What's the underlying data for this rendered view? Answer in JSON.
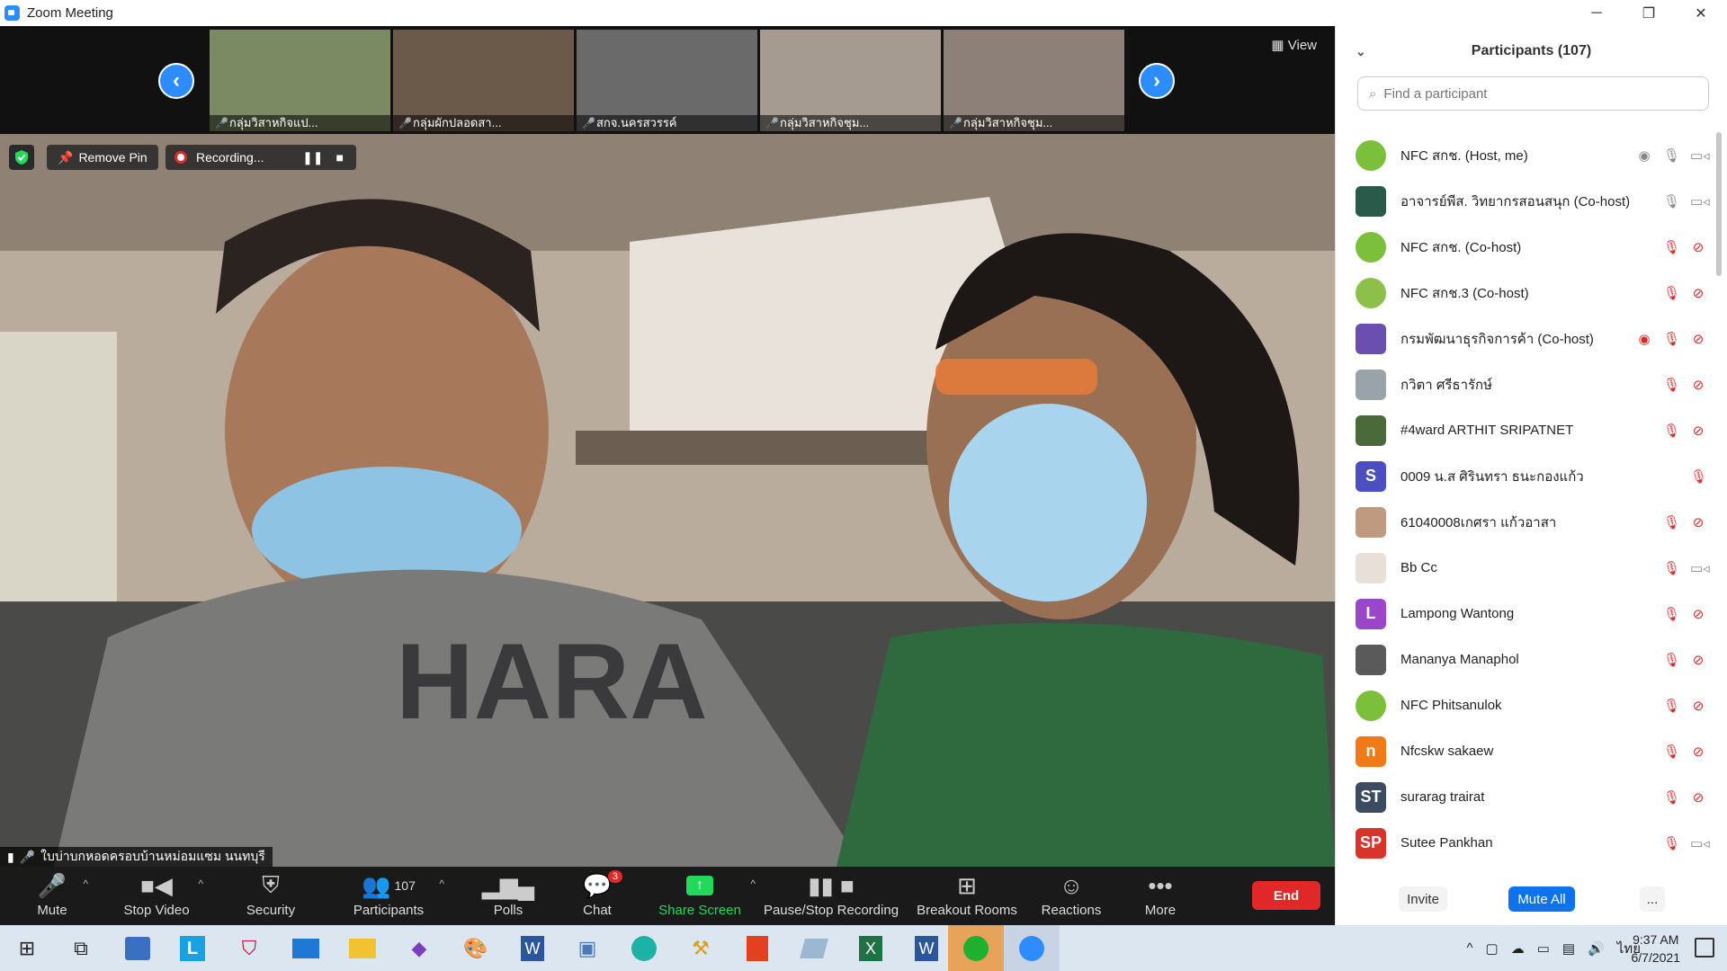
{
  "window": {
    "title": "Zoom Meeting",
    "controls": [
      "─",
      "❐",
      "✕"
    ]
  },
  "top_strip": {
    "prev": "‹",
    "next": "›",
    "view_label": "View",
    "thumbs": [
      {
        "name": "กลุ่มวิสาหกิจแป...",
        "bg": "#7c8a63"
      },
      {
        "name": "กลุ่มผักปลอดสา...",
        "bg": "#6b5a4a"
      },
      {
        "name": "สกจ.นครสวรรค์",
        "bg": "#6a6a6a"
      },
      {
        "name": "กลุ่มวิสาหกิจชุม...",
        "bg": "#a59b90"
      },
      {
        "name": "กลุ่มวิสาหกิจชุม...",
        "bg": "#8c8078"
      }
    ]
  },
  "main_video": {
    "remove_pin": "Remove Pin",
    "recording": "Recording...",
    "speaker_name": "ใบบ่าบกหอดครอบบ้านหม่อมแซม นนทบุรี"
  },
  "toolbar": {
    "mute": "Mute",
    "stop_video": "Stop Video",
    "security": "Security",
    "participants": "Participants",
    "participants_count": "107",
    "polls": "Polls",
    "chat": "Chat",
    "chat_badge": "3",
    "share": "Share Screen",
    "recording": "Pause/Stop Recording",
    "breakout": "Breakout Rooms",
    "reactions": "Reactions",
    "more": "More",
    "end": "End"
  },
  "participants_panel": {
    "title": "Participants (107)",
    "search_placeholder": "Find a participant",
    "invite": "Invite",
    "mute_all": "Mute All",
    "more": "...",
    "list": [
      {
        "name": "NFC สกช. (Host, me)",
        "avatar": "",
        "color": "#7bbf3a",
        "icons": "host"
      },
      {
        "name": "อาจารย์พีส. วิทยากรสอนสนุก (Co-host)",
        "avatar": "",
        "color": "#2a5a4a",
        "icons": "mic_on"
      },
      {
        "name": "NFC สกช. (Co-host)",
        "avatar": "",
        "color": "#7bbf3a",
        "icons": "muted"
      },
      {
        "name": "NFC สกช.3 (Co-host)",
        "avatar": "",
        "color": "#8cc04a",
        "icons": "muted"
      },
      {
        "name": "กรมพัฒนาธุรกิจการค้า (Co-host)",
        "avatar": "",
        "color": "#6a4fb0",
        "icons": "rec_muted"
      },
      {
        "name": "กวิตา ศรีธารักษ์",
        "avatar": "",
        "color": "#9aa4a8",
        "icons": "muted"
      },
      {
        "name": "#4ward  ARTHIT SRIPATNET",
        "avatar": "",
        "color": "#4a6a3a",
        "icons": "muted"
      },
      {
        "name": "0009 น.ส ศิรินทรา ธนะกองแก้ว",
        "avatar": "S",
        "color": "#4b4fbf",
        "icons": "mic_only_muted"
      },
      {
        "name": "61040008เกศรา แก้วอาสา",
        "avatar": "",
        "color": "#c09a80",
        "icons": "muted"
      },
      {
        "name": "Bb Cc",
        "avatar": "",
        "color": "#e8e0d8",
        "icons": "muted_vid_on"
      },
      {
        "name": "Lampong Wantong",
        "avatar": "L",
        "color": "#9b45c9",
        "icons": "muted"
      },
      {
        "name": "Mananya Manaphol",
        "avatar": "",
        "color": "#5a5a5a",
        "icons": "muted"
      },
      {
        "name": "NFC Phitsanulok",
        "avatar": "",
        "color": "#7bbf3a",
        "icons": "muted"
      },
      {
        "name": "Nfcskw sakaew",
        "avatar": "n",
        "color": "#f07a18",
        "icons": "muted"
      },
      {
        "name": "surarag trairat",
        "avatar": "ST",
        "color": "#3b4c60",
        "icons": "muted"
      },
      {
        "name": "Sutee Pankhan",
        "avatar": "SP",
        "color": "#d9332b",
        "icons": "muted_vid_on"
      }
    ]
  },
  "taskbar": {
    "time": "9:37 AM",
    "date": "6/7/2021",
    "lang": "ไทย"
  }
}
